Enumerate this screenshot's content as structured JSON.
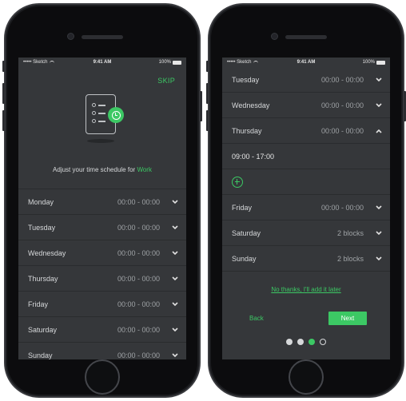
{
  "status_bar": {
    "carrier": "••••• Sketch",
    "time": "9:41 AM",
    "battery": "100%"
  },
  "screen1": {
    "skip_label": "SKIP",
    "caption_prefix": "Adjust your time schedule for",
    "caption_accent": "Work",
    "days": [
      {
        "day": "Monday",
        "time": "00:00 - 00:00"
      },
      {
        "day": "Tuesday",
        "time": "00:00 - 00:00"
      },
      {
        "day": "Wednesday",
        "time": "00:00 - 00:00"
      },
      {
        "day": "Thursday",
        "time": "00:00 - 00:00"
      },
      {
        "day": "Friday",
        "time": "00:00 - 00:00"
      },
      {
        "day": "Saturday",
        "time": "00:00 - 00:00"
      },
      {
        "day": "Sunday",
        "time": "00:00 - 00:00"
      }
    ]
  },
  "screen2": {
    "rows_top": [
      {
        "day": "Tuesday",
        "time": "00:00 - 00:00"
      },
      {
        "day": "Wednesday",
        "time": "00:00 - 00:00"
      },
      {
        "day": "Thursday",
        "time": "00:00 - 00:00"
      }
    ],
    "expanded_block": "09:00 - 17:00",
    "rows_bottom": [
      {
        "day": "Friday",
        "time": "00:00 - 00:00"
      },
      {
        "day": "Saturday",
        "time": "2 blocks"
      },
      {
        "day": "Sunday",
        "time": "2 blocks"
      }
    ],
    "later_link": "No thanks, I'll add it later",
    "back_label": "Back",
    "next_label": "Next",
    "page_total": 4,
    "page_current": 3
  },
  "colors": {
    "accent": "#3cc864",
    "screen_bg": "#35373a",
    "divider": "#2a2c2e",
    "text": "#d6d8da"
  }
}
